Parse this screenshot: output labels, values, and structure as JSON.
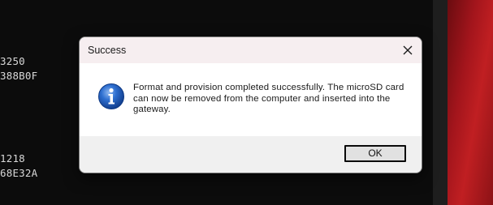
{
  "console": {
    "lines": [
      "3250",
      "388B0F",
      "1218",
      "68E32A"
    ]
  },
  "dialog": {
    "title": "Success",
    "close_icon": "close-icon",
    "info_icon": "information-icon",
    "message": "Format and provision completed successfully. The microSD card can now be removed from the computer and inserted into the gateway.",
    "ok_label": "OK"
  },
  "colors": {
    "console_bg": "#0c0c0c",
    "titlebar_bg": "#f6eef0",
    "footer_bg": "#f0f0f0",
    "info_blue": "#1f5fbf",
    "wallpaper_red": "#c01f22"
  }
}
